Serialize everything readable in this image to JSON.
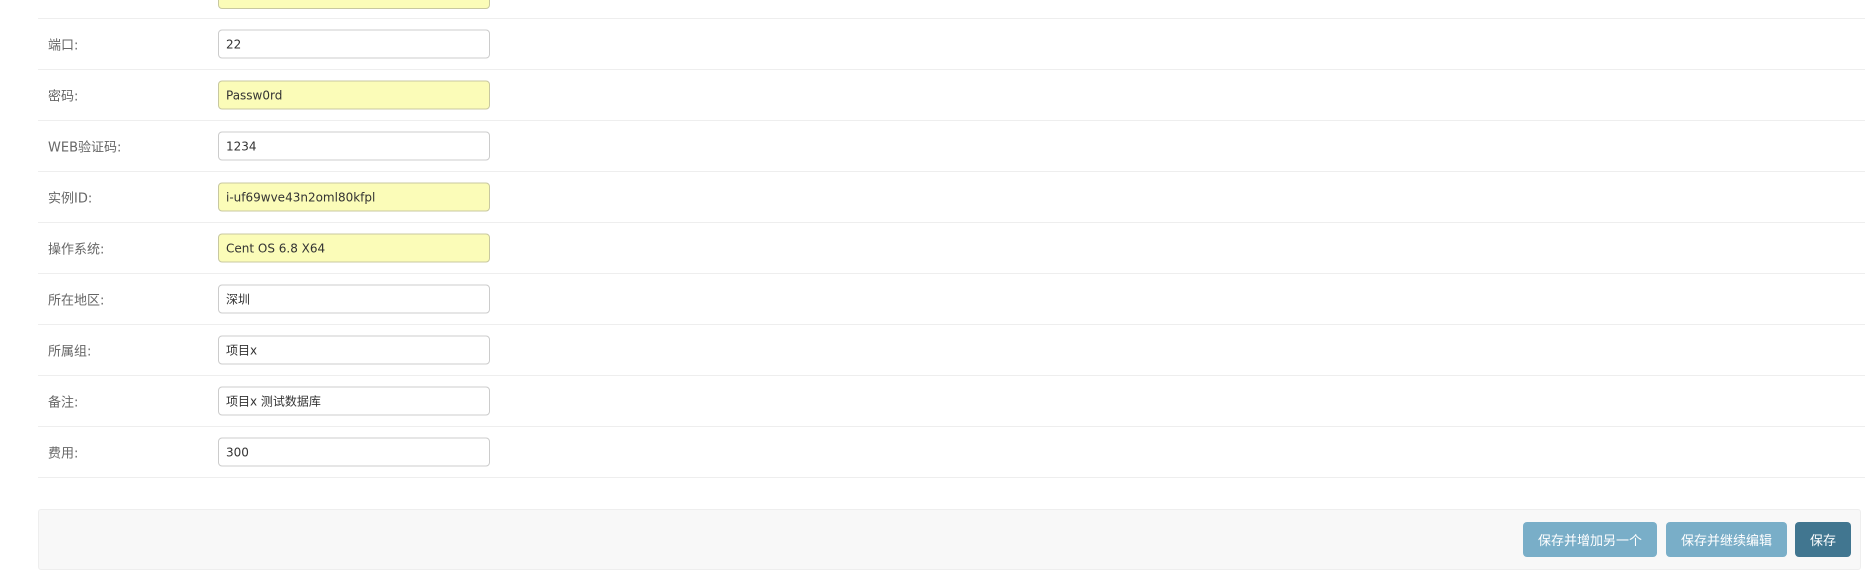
{
  "form": {
    "fields": [
      {
        "label": "",
        "value": ""
      },
      {
        "label": "端口:",
        "value": "22"
      },
      {
        "label": "密码:",
        "value": "Passw0rd"
      },
      {
        "label": "WEB验证码:",
        "value": "1234"
      },
      {
        "label": "实例ID:",
        "value": "i-uf69wve43n2oml80kfpl"
      },
      {
        "label": "操作系统:",
        "value": "Cent OS 6.8 X64"
      },
      {
        "label": "所在地区:",
        "value": "深圳"
      },
      {
        "label": "所属组:",
        "value": "项目x"
      },
      {
        "label": "备注:",
        "value": "项目x 测试数据库"
      },
      {
        "label": "费用:",
        "value": "300"
      }
    ]
  },
  "submit_row": {
    "save_add_another_label": "保存并增加另一个",
    "save_continue_label": "保存并继续编辑",
    "save_label": "保存"
  },
  "colors": {
    "autofill_background": "#fbfcb8",
    "button_secondary": "#79aec8",
    "button_primary": "#417690"
  }
}
